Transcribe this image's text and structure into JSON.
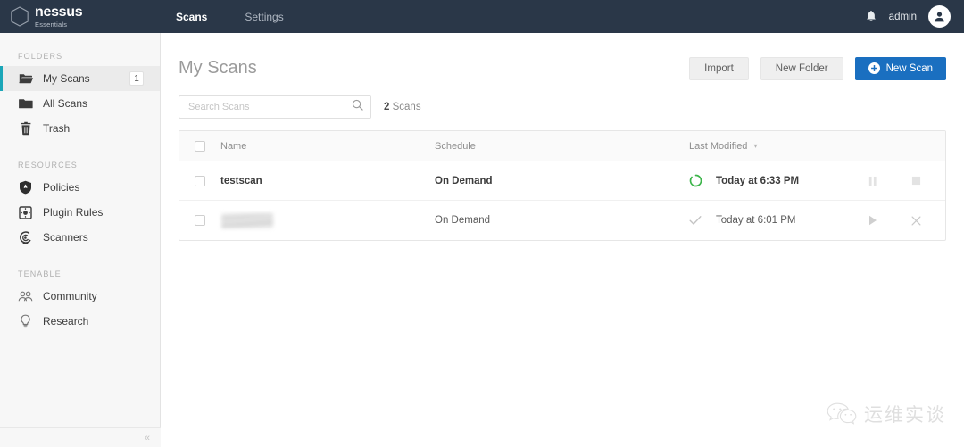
{
  "topbar": {
    "brand_name": "nessus",
    "brand_sub": "Essentials",
    "nav": [
      {
        "label": "Scans",
        "active": true
      },
      {
        "label": "Settings",
        "active": false
      }
    ],
    "notification_icon": "bell-icon",
    "user_label": "admin",
    "avatar_icon": "user-avatar-icon"
  },
  "sidebar": {
    "sections": [
      {
        "title": "FOLDERS",
        "items": [
          {
            "label": "My Scans",
            "icon": "folder-open-icon",
            "badge": "1",
            "active": true
          },
          {
            "label": "All Scans",
            "icon": "folder-icon",
            "badge": "",
            "active": false
          },
          {
            "label": "Trash",
            "icon": "trash-icon",
            "badge": "",
            "active": false
          }
        ]
      },
      {
        "title": "RESOURCES",
        "items": [
          {
            "label": "Policies",
            "icon": "shield-icon",
            "badge": "",
            "active": false
          },
          {
            "label": "Plugin Rules",
            "icon": "plugin-icon",
            "badge": "",
            "active": false
          },
          {
            "label": "Scanners",
            "icon": "scanner-radar-icon",
            "badge": "",
            "active": false
          }
        ]
      },
      {
        "title": "TENABLE",
        "items": [
          {
            "label": "Community",
            "icon": "community-people-icon",
            "badge": "",
            "active": false
          },
          {
            "label": "Research",
            "icon": "research-bulb-icon",
            "badge": "",
            "active": false
          }
        ]
      }
    ],
    "collapse_glyph": "«"
  },
  "page": {
    "title": "My Scans",
    "buttons": {
      "import": "Import",
      "new_folder": "New Folder",
      "new_scan": "New Scan"
    }
  },
  "search": {
    "placeholder": "Search Scans",
    "value": "",
    "icon": "search-icon",
    "count_number": "2",
    "count_label": "Scans"
  },
  "table": {
    "headers": {
      "name": "Name",
      "schedule": "Schedule",
      "last_modified": "Last Modified",
      "sort_caret": "▾"
    },
    "rows": [
      {
        "name": "testscan",
        "name_redacted": false,
        "schedule": "On Demand",
        "status_icon": "running-spinner-icon",
        "last_modified": "Today at 6:33 PM",
        "emphasis": true,
        "actions": [
          "pause-icon",
          "stop-icon"
        ]
      },
      {
        "name": "",
        "name_redacted": true,
        "schedule": "On Demand",
        "status_icon": "completed-check-icon",
        "last_modified": "Today at 6:01 PM",
        "emphasis": false,
        "actions": [
          "play-icon",
          "close-icon"
        ]
      }
    ]
  },
  "watermark": {
    "icon": "wechat-icon",
    "text": "运维实谈"
  },
  "colors": {
    "topbar_bg": "#2a3748",
    "accent_teal": "#1ba6b8",
    "primary_blue": "#1a6fc0",
    "running_green": "#3cb54a",
    "sidebar_bg": "#f7f7f7"
  }
}
